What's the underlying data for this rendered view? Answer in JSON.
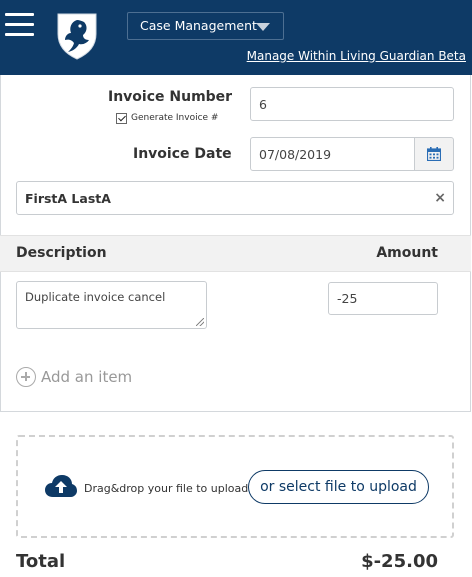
{
  "header": {
    "menu_icon": "hamburger-icon",
    "logo_icon": "shield-eagle-logo",
    "case_select_value": "Case Management",
    "manage_link": "Manage Within Living Guardian Beta",
    "bg_color": "#0e3a66"
  },
  "invoice": {
    "number_label": "Invoice Number",
    "number_value": "6",
    "generate_label": "Generate Invoice #",
    "generate_checked": true,
    "date_label": "Invoice Date",
    "date_value": "07/08/2019",
    "calendar_icon": "calendar-icon",
    "client_name": "FirstA LastA",
    "clear_icon": "×"
  },
  "items": {
    "description_header": "Description",
    "amount_header": "Amount",
    "rows": [
      {
        "description": "Duplicate invoice cancel",
        "amount": "-25"
      }
    ],
    "add_item_label": "Add an item"
  },
  "upload": {
    "cloud_icon": "cloud-upload-icon",
    "drag_text": "Drag&drop your file to upload",
    "select_button": "or select file to upload"
  },
  "total": {
    "label": "Total",
    "value": "$-25.00"
  }
}
